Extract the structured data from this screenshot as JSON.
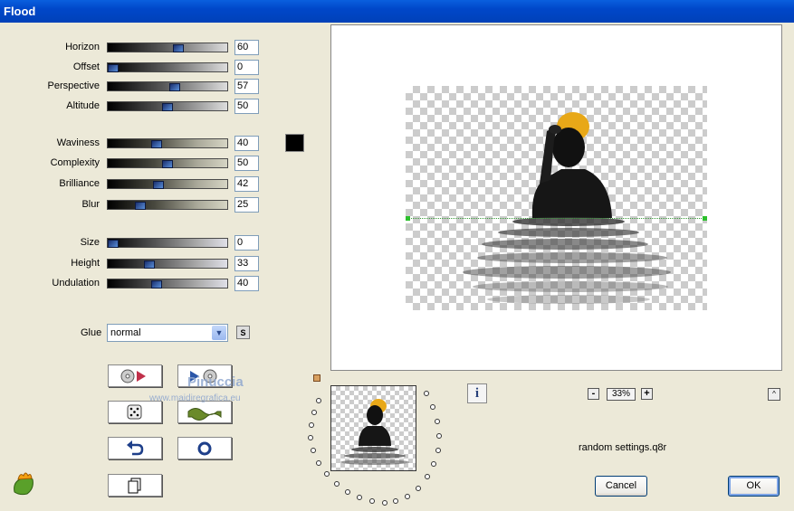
{
  "window": {
    "title": "Flood"
  },
  "sliders": [
    {
      "label": "Horizon",
      "value": "60",
      "fraction": 0.6
    },
    {
      "label": "Offset",
      "value": "0",
      "fraction": 0.0
    },
    {
      "label": "Perspective",
      "value": "57",
      "fraction": 0.57
    },
    {
      "label": "Altitude",
      "value": "50",
      "fraction": 0.5
    },
    {
      "label": "Waviness",
      "value": "40",
      "fraction": 0.4
    },
    {
      "label": "Complexity",
      "value": "50",
      "fraction": 0.5
    },
    {
      "label": "Brilliance",
      "value": "42",
      "fraction": 0.42
    },
    {
      "label": "Blur",
      "value": "25",
      "fraction": 0.25
    },
    {
      "label": "Size",
      "value": "0",
      "fraction": 0.0
    },
    {
      "label": "Height",
      "value": "33",
      "fraction": 0.33
    },
    {
      "label": "Undulation",
      "value": "40",
      "fraction": 0.4
    }
  ],
  "color": {
    "swatch": "#000000"
  },
  "glue": {
    "label": "Glue",
    "value": "normal",
    "s_button": "S"
  },
  "watermark": {
    "line1": "Pinuccia",
    "line2": "www.maidiregrafica.eu"
  },
  "zoom": {
    "minus": "-",
    "value": "33%",
    "plus": "+"
  },
  "preview": {
    "scroll_up": "^"
  },
  "info": {
    "label": "i"
  },
  "settings_file": "random settings.q8r",
  "buttons": {
    "cancel": "Cancel",
    "ok": "OK"
  }
}
